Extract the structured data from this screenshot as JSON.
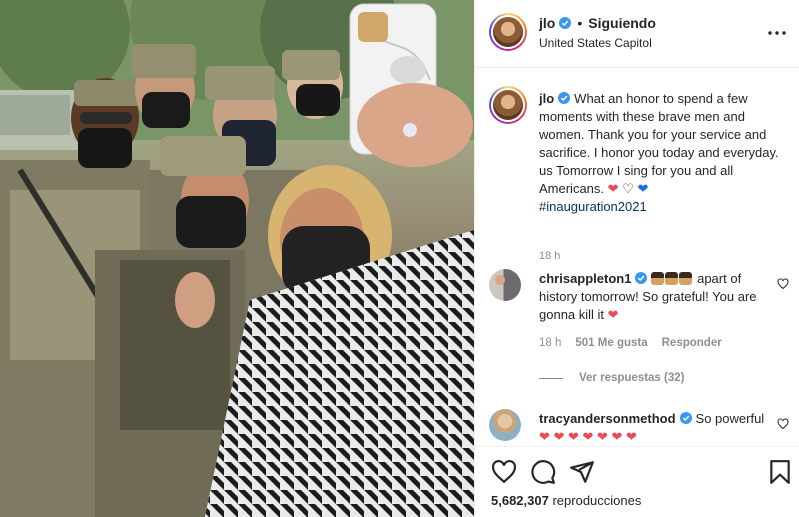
{
  "post": {
    "username": "jlo",
    "follow_state": "Siguiendo",
    "separator": "•",
    "location": "United States Capitol",
    "more_icon": "more-horizontal-icon"
  },
  "caption": {
    "username": "jlo",
    "text": "What an honor to spend a few moments with these brave men and women. Thank you for your service and sacrifice. I honor you today and everyday. us Tomorrow I sing for you and all Americans.",
    "hearts": [
      "❤",
      "♡",
      "❤"
    ],
    "hashtag": "#inauguration2021",
    "time": "18 h"
  },
  "comments": [
    {
      "username": "chrisappleton1",
      "emoji_count": 3,
      "text": "apart of history tomorrow! So grateful! You are gonna kill it",
      "trailing_emoji": "❤",
      "time": "18 h",
      "likes": "501 Me gusta",
      "reply_label": "Responder",
      "view_replies": "Ver respuestas (32)"
    },
    {
      "username": "tracyandersonmethod",
      "text": "So powerful",
      "trailing_emoji": "❤ ❤ ❤ ❤ ❤ ❤ ❤"
    }
  ],
  "actions": {
    "like_icon": "heart-outline-icon",
    "comment_icon": "comment-icon",
    "share_icon": "paper-plane-icon",
    "save_icon": "bookmark-icon"
  },
  "stats": {
    "views_count": "5,682,307",
    "views_label": "reproducciones"
  }
}
